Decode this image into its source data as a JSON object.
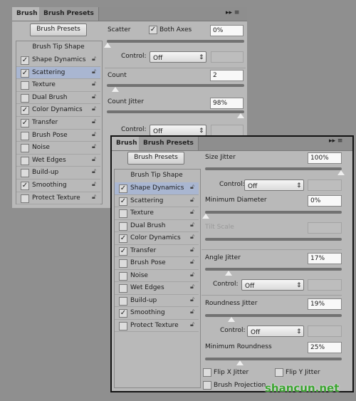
{
  "back_panel": {
    "tabs": [
      "Brush",
      "Brush Presets"
    ],
    "presets_button": "Brush Presets",
    "tip_shape": "Brush Tip Shape",
    "selected": "Scattering",
    "items": [
      {
        "label": "Shape Dynamics",
        "checked": true
      },
      {
        "label": "Scattering",
        "checked": true
      },
      {
        "label": "Texture",
        "checked": false
      },
      {
        "label": "Dual Brush",
        "checked": false
      },
      {
        "label": "Color Dynamics",
        "checked": true
      },
      {
        "label": "Transfer",
        "checked": true
      },
      {
        "label": "Brush Pose",
        "checked": false
      },
      {
        "label": "Noise",
        "checked": false
      },
      {
        "label": "Wet Edges",
        "checked": false
      },
      {
        "label": "Build-up",
        "checked": false
      },
      {
        "label": "Smoothing",
        "checked": true
      },
      {
        "label": "Protect Texture",
        "checked": false
      }
    ],
    "settings": {
      "scatter": {
        "label": "Scatter",
        "value": "0%",
        "both_axes_label": "Both Axes",
        "both_axes": true,
        "slider": 0
      },
      "control1": {
        "label": "Control:",
        "value": "Off"
      },
      "count": {
        "label": "Count",
        "value": "2",
        "slider": 0.06
      },
      "count_jitter": {
        "label": "Count Jitter",
        "value": "98%",
        "slider": 0.98
      },
      "control2": {
        "label": "Control:",
        "value": "Off"
      }
    }
  },
  "front_panel": {
    "tabs": [
      "Brush",
      "Brush Presets"
    ],
    "presets_button": "Brush Presets",
    "tip_shape": "Brush Tip Shape",
    "selected": "Shape Dynamics",
    "items": [
      {
        "label": "Shape Dynamics",
        "checked": true
      },
      {
        "label": "Scattering",
        "checked": true
      },
      {
        "label": "Texture",
        "checked": false
      },
      {
        "label": "Dual Brush",
        "checked": false
      },
      {
        "label": "Color Dynamics",
        "checked": true
      },
      {
        "label": "Transfer",
        "checked": true
      },
      {
        "label": "Brush Pose",
        "checked": false
      },
      {
        "label": "Noise",
        "checked": false
      },
      {
        "label": "Wet Edges",
        "checked": false
      },
      {
        "label": "Build-up",
        "checked": false
      },
      {
        "label": "Smoothing",
        "checked": true
      },
      {
        "label": "Protect Texture",
        "checked": false
      }
    ],
    "settings": {
      "size_jitter": {
        "label": "Size Jitter",
        "value": "100%",
        "slider": 1.0
      },
      "control1": {
        "label": "Control:",
        "value": "Off"
      },
      "min_diameter": {
        "label": "Minimum Diameter",
        "value": "0%",
        "slider": 0
      },
      "tilt_scale": {
        "label": "Tilt Scale",
        "value": ""
      },
      "angle_jitter": {
        "label": "Angle Jitter",
        "value": "17%",
        "slider": 0.17
      },
      "control2": {
        "label": "Control:",
        "value": "Off"
      },
      "roundness_jitter": {
        "label": "Roundness Jitter",
        "value": "19%",
        "slider": 0.19
      },
      "control3": {
        "label": "Control:",
        "value": "Off"
      },
      "min_roundness": {
        "label": "Minimum Roundness",
        "value": "25%",
        "slider": 0.25
      },
      "flip_x": {
        "label": "Flip X Jitter",
        "checked": false
      },
      "flip_y": {
        "label": "Flip Y Jitter",
        "checked": false
      },
      "brush_projection": {
        "label": "Brush Projection",
        "checked": false
      }
    }
  },
  "watermark": "shancun.net",
  "colors": {
    "selected_row": "#a9b6d1",
    "panel_bg": "#b9b9b9",
    "watermark": "#3aa52f"
  }
}
